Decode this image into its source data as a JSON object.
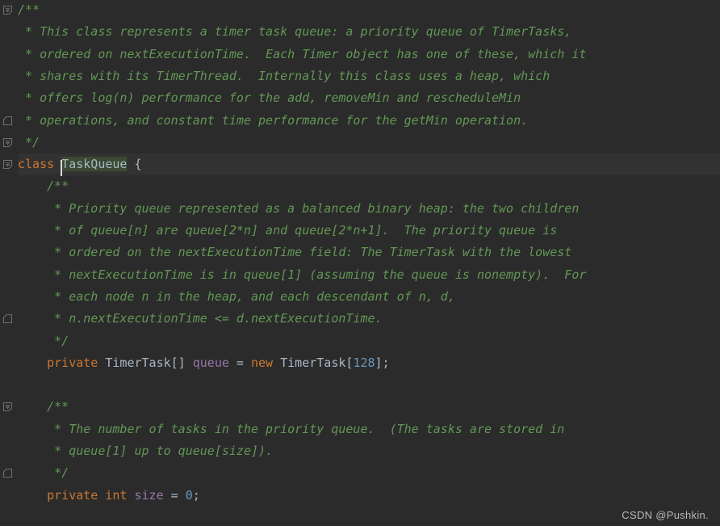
{
  "editor": {
    "theme": "darcula",
    "background": "#2b2b2b",
    "current_line_background": "#323232",
    "selection_background": "#3a4a33",
    "colors": {
      "comment": "#629755",
      "keyword": "#cc7832",
      "type": "#a9b7c6",
      "field": "#9876aa",
      "number": "#6897bb",
      "punctuation": "#a9b7c6",
      "caret": "#d9d9d9"
    },
    "caret_text": "TaskQueue",
    "selected_text": "TaskQueue"
  },
  "watermark": {
    "text": "CSDN @Pushkin."
  },
  "gutter": {
    "fold_markers": [
      {
        "line": 0,
        "kind": "fold-start-icon"
      },
      {
        "line": 5,
        "kind": "fold-end-icon"
      },
      {
        "line": 6,
        "kind": "fold-start-icon"
      },
      {
        "line": 7,
        "kind": "fold-start-icon"
      },
      {
        "line": 14,
        "kind": "fold-end-icon"
      },
      {
        "line": 18,
        "kind": "fold-start-icon"
      },
      {
        "line": 21,
        "kind": "fold-end-icon"
      }
    ]
  },
  "code": {
    "lines": [
      {
        "n": 0,
        "segments": [
          {
            "t": "/**",
            "c": "cmt"
          }
        ]
      },
      {
        "n": 1,
        "segments": [
          {
            "t": " * This class represents a timer task queue: a priority queue of TimerTasks,",
            "c": "cmt"
          }
        ]
      },
      {
        "n": 2,
        "segments": [
          {
            "t": " * ordered on nextExecutionTime.  Each Timer object has one of these, which it",
            "c": "cmt"
          }
        ]
      },
      {
        "n": 3,
        "segments": [
          {
            "t": " * shares with its TimerThread.  Internally this class uses a heap, which",
            "c": "cmt"
          }
        ]
      },
      {
        "n": 4,
        "segments": [
          {
            "t": " * offers log(n) performance for the add, removeMin and rescheduleMin",
            "c": "cmt"
          }
        ]
      },
      {
        "n": 5,
        "segments": [
          {
            "t": " * operations, and constant time performance for the getMin operation.",
            "c": "cmt"
          }
        ]
      },
      {
        "n": 6,
        "segments": [
          {
            "t": " */",
            "c": "cmt"
          }
        ]
      },
      {
        "n": 7,
        "current": true,
        "segments": [
          {
            "t": "class ",
            "c": "kw"
          },
          {
            "t": "TaskQueue",
            "c": "typ",
            "selected": true,
            "caret_before": true
          },
          {
            "t": " {",
            "c": "pun"
          }
        ]
      },
      {
        "n": 8,
        "segments": [
          {
            "t": "    /**",
            "c": "cmt"
          }
        ]
      },
      {
        "n": 9,
        "segments": [
          {
            "t": "     * Priority queue represented as a balanced binary heap: the two children",
            "c": "cmt"
          }
        ]
      },
      {
        "n": 10,
        "segments": [
          {
            "t": "     * of queue[n] are queue[2*n] and queue[2*n+1].  The priority queue is",
            "c": "cmt"
          }
        ]
      },
      {
        "n": 11,
        "segments": [
          {
            "t": "     * ordered on the nextExecutionTime field: The TimerTask with the lowest",
            "c": "cmt"
          }
        ]
      },
      {
        "n": 12,
        "segments": [
          {
            "t": "     * nextExecutionTime is in queue[1] (assuming the queue is nonempty).  For",
            "c": "cmt"
          }
        ]
      },
      {
        "n": 13,
        "segments": [
          {
            "t": "     * each node n in the heap, and each descendant of n, d,",
            "c": "cmt"
          }
        ]
      },
      {
        "n": 14,
        "segments": [
          {
            "t": "     * n.nextExecutionTime <= d.nextExecutionTime.",
            "c": "cmt"
          }
        ]
      },
      {
        "n": 15,
        "segments": [
          {
            "t": "     */",
            "c": "cmt"
          }
        ]
      },
      {
        "n": 16,
        "segments": [
          {
            "t": "    ",
            "c": "pun"
          },
          {
            "t": "private",
            "c": "kw"
          },
          {
            "t": " ",
            "c": "pun"
          },
          {
            "t": "TimerTask[]",
            "c": "typ"
          },
          {
            "t": " ",
            "c": "pun"
          },
          {
            "t": "queue",
            "c": "fld"
          },
          {
            "t": " = ",
            "c": "pun"
          },
          {
            "t": "new",
            "c": "kw"
          },
          {
            "t": " ",
            "c": "pun"
          },
          {
            "t": "TimerTask[",
            "c": "typ"
          },
          {
            "t": "128",
            "c": "num"
          },
          {
            "t": "];",
            "c": "pun"
          }
        ]
      },
      {
        "n": 17,
        "segments": [
          {
            "t": "",
            "c": "pun"
          }
        ]
      },
      {
        "n": 18,
        "segments": [
          {
            "t": "    /**",
            "c": "cmt"
          }
        ]
      },
      {
        "n": 19,
        "segments": [
          {
            "t": "     * The number of tasks in the priority queue.  (The tasks are stored in",
            "c": "cmt"
          }
        ]
      },
      {
        "n": 20,
        "segments": [
          {
            "t": "     * queue[1] up to queue[size]).",
            "c": "cmt"
          }
        ]
      },
      {
        "n": 21,
        "segments": [
          {
            "t": "     */",
            "c": "cmt"
          }
        ]
      },
      {
        "n": 22,
        "segments": [
          {
            "t": "    ",
            "c": "pun"
          },
          {
            "t": "private",
            "c": "kw"
          },
          {
            "t": " ",
            "c": "pun"
          },
          {
            "t": "int",
            "c": "kw"
          },
          {
            "t": " ",
            "c": "pun"
          },
          {
            "t": "size",
            "c": "fld"
          },
          {
            "t": " = ",
            "c": "pun"
          },
          {
            "t": "0",
            "c": "num"
          },
          {
            "t": ";",
            "c": "pun"
          }
        ]
      }
    ]
  }
}
